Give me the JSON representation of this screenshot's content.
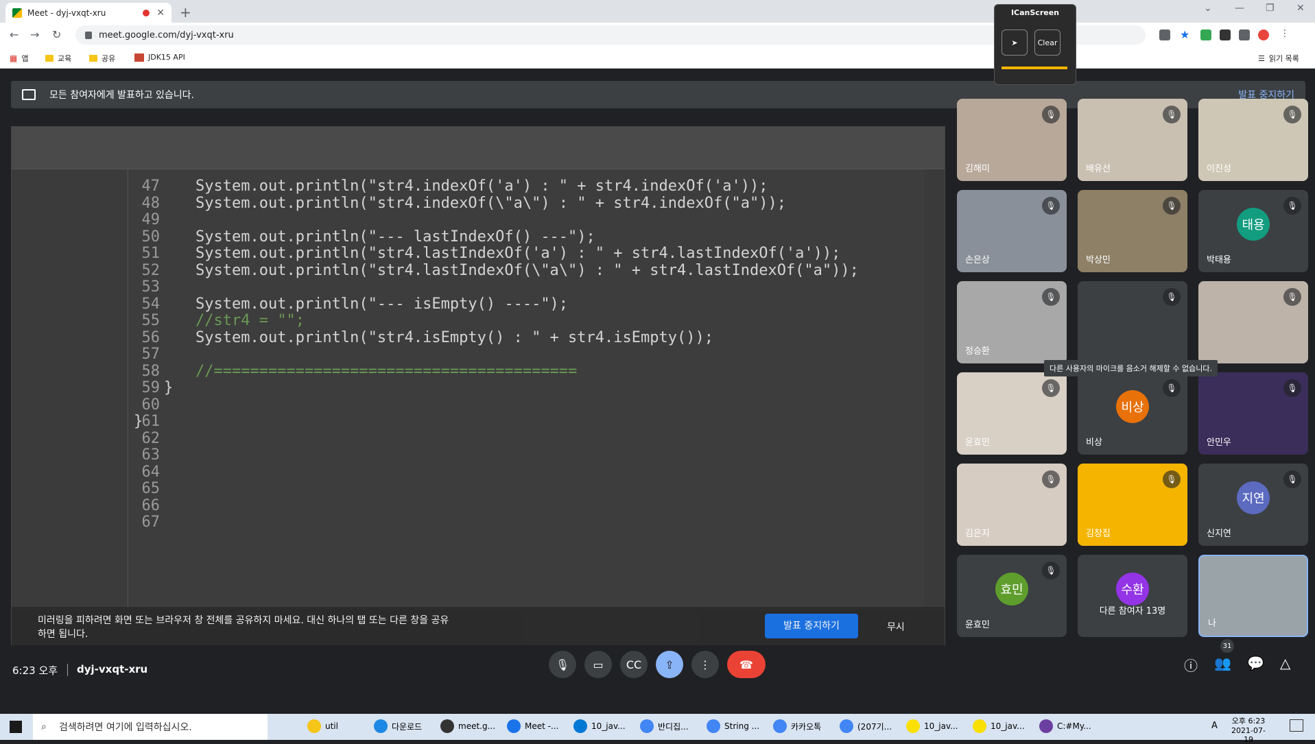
{
  "browser": {
    "tab_title": "Meet - dyj-vxqt-xru",
    "url": "meet.google.com/dyj-vxqt-xru",
    "bookmarks": [
      "앱",
      "교육",
      "공유",
      "JDK15 API"
    ],
    "reading_list": "읽기 목록"
  },
  "icanscreen": {
    "title": "ICanScreen",
    "clear_label": "Clear"
  },
  "banner": {
    "text": "모든 참여자에게 발표하고 있습니다.",
    "stop_label": "발표 중지하기"
  },
  "code": {
    "lines": [
      {
        "n": "47",
        "t": "System.out.println(\"str4.indexOf('a') : \" + str4.indexOf('a'));"
      },
      {
        "n": "48",
        "t": "System.out.println(\"str4.indexOf(\\\"a\\\") : \" + str4.indexOf(\"a\"));"
      },
      {
        "n": "49",
        "t": ""
      },
      {
        "n": "50",
        "t": "System.out.println(\"--- lastIndexOf() ---\");"
      },
      {
        "n": "51",
        "t": "System.out.println(\"str4.lastIndexOf('a') : \" + str4.lastIndexOf('a'));"
      },
      {
        "n": "52",
        "t": "System.out.println(\"str4.lastIndexOf(\\\"a\\\") : \" + str4.lastIndexOf(\"a\"));"
      },
      {
        "n": "53",
        "t": ""
      },
      {
        "n": "54",
        "t": "System.out.println(\"--- isEmpty() ----\");"
      },
      {
        "n": "55",
        "t": "//str4 = \"\";"
      },
      {
        "n": "56",
        "t": "System.out.println(\"str4.isEmpty() : \" + str4.isEmpty());"
      },
      {
        "n": "57",
        "t": ""
      },
      {
        "n": "58",
        "t": "//========================================"
      },
      {
        "n": "59",
        "t": "}"
      },
      {
        "n": "60",
        "t": ""
      },
      {
        "n": "61",
        "t": "}"
      },
      {
        "n": "62",
        "t": ""
      },
      {
        "n": "63",
        "t": ""
      },
      {
        "n": "64",
        "t": ""
      },
      {
        "n": "65",
        "t": ""
      },
      {
        "n": "66",
        "t": ""
      },
      {
        "n": "67",
        "t": ""
      }
    ]
  },
  "warning": {
    "text": "미러링을 피하려면 화면 또는 브라우저 창 전체를 공유하지 마세요. 대신 하나의 탭 또는 다른 창을 공유하면 됩니다.",
    "stop_label": "발표 중지하기",
    "ignore_label": "무시"
  },
  "participants": [
    {
      "name": "김해미",
      "initials": "",
      "color": "#b7a89a"
    },
    {
      "name": "배유선",
      "initials": "",
      "color": "#c9c0b2"
    },
    {
      "name": "이진성",
      "initials": "",
      "color": "#cfc7b6"
    },
    {
      "name": "손은상",
      "initials": "",
      "color": "#8a9099"
    },
    {
      "name": "박상민",
      "initials": "",
      "color": "#8d8067"
    },
    {
      "name": "박태용",
      "initials": "태용",
      "color": "#129c80"
    },
    {
      "name": "정승환",
      "initials": "",
      "color": "#a8a8a8"
    },
    {
      "name": "",
      "initials": "",
      "color": "#3c4043"
    },
    {
      "name": "",
      "initials": "",
      "color": "#bdb3a8"
    },
    {
      "name": "윤효민",
      "initials": "",
      "color": "#d8d0c5"
    },
    {
      "name": "비상",
      "initials": "비상",
      "color": "#e8710a"
    },
    {
      "name": "안민우",
      "initials": "",
      "color": "#3b2e5a"
    },
    {
      "name": "김은지",
      "initials": "",
      "color": "#d7ccc2"
    },
    {
      "name": "김창집",
      "initials": "",
      "color": "#f4b400"
    },
    {
      "name": "신지연",
      "initials": "지연",
      "color": "#5c6bc0"
    },
    {
      "name": "윤효민",
      "initials": "효민",
      "color": "#5f9e2d"
    },
    {
      "name": "다른 참여자 13명",
      "initials": "수환",
      "color": "#9334e6"
    },
    {
      "name": "나",
      "initials": "",
      "color": "#9aa3a8"
    }
  ],
  "tooltip": "다른 사용자의 마이크를 음소거 해제할 수 없습니다.",
  "bottom": {
    "time": "6:23 오후",
    "meeting_code": "dyj-vxqt-xru",
    "people_count": "31"
  },
  "taskbar": {
    "search_placeholder": "검색하려면 여기에 입력하십시오.",
    "items": [
      "util",
      "다운로드",
      "meet.g...",
      "Meet -...",
      "10_jav...",
      "반디집...",
      "String ...",
      "카카오톡",
      "(207기...",
      "10_jav...",
      "10_jav...",
      "C:#My..."
    ],
    "clock_time": "오후 6:23",
    "clock_date": "2021-07-19",
    "ime": "A"
  }
}
